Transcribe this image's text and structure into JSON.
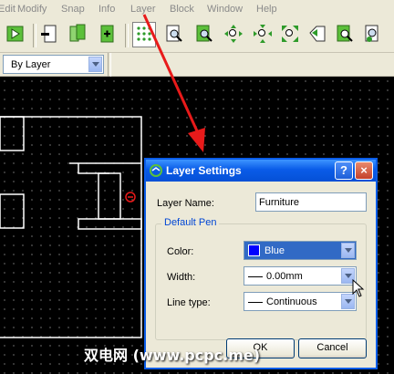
{
  "menu": [
    "Edit",
    "Modify",
    "Snap",
    "Info",
    "Layer",
    "Block",
    "Window",
    "Help"
  ],
  "toolbar": {
    "icons": [
      "select-icon",
      "zoom-out-icon",
      "copy-icon",
      "add-icon",
      "grid-icon",
      "zoom-window-icon",
      "zoom-page-icon",
      "zoom-in-icon",
      "zoom-out-small-icon",
      "zoom-auto-icon",
      "zoom-previous-icon",
      "zoom-redraw-icon",
      "zoom-pan-icon"
    ]
  },
  "propbar": {
    "pen_select": "By Layer"
  },
  "annotation": {
    "arrow_color": "#e81a1a"
  },
  "dialog": {
    "title": "Layer Settings",
    "help_glyph": "?",
    "close_glyph": "×",
    "layer_name_label": "Layer Name:",
    "layer_name_value": "Furniture",
    "group_title": "Default Pen",
    "color_label": "Color:",
    "color_value": "Blue",
    "color_swatch": "#0000ff",
    "width_label": "Width:",
    "width_value": "0.00mm",
    "linetype_label": "Line type:",
    "linetype_value": "Continuous",
    "ok_label": "OK",
    "cancel_label": "Cancel"
  },
  "watermark": "双电网 (www.pcpc.me)"
}
